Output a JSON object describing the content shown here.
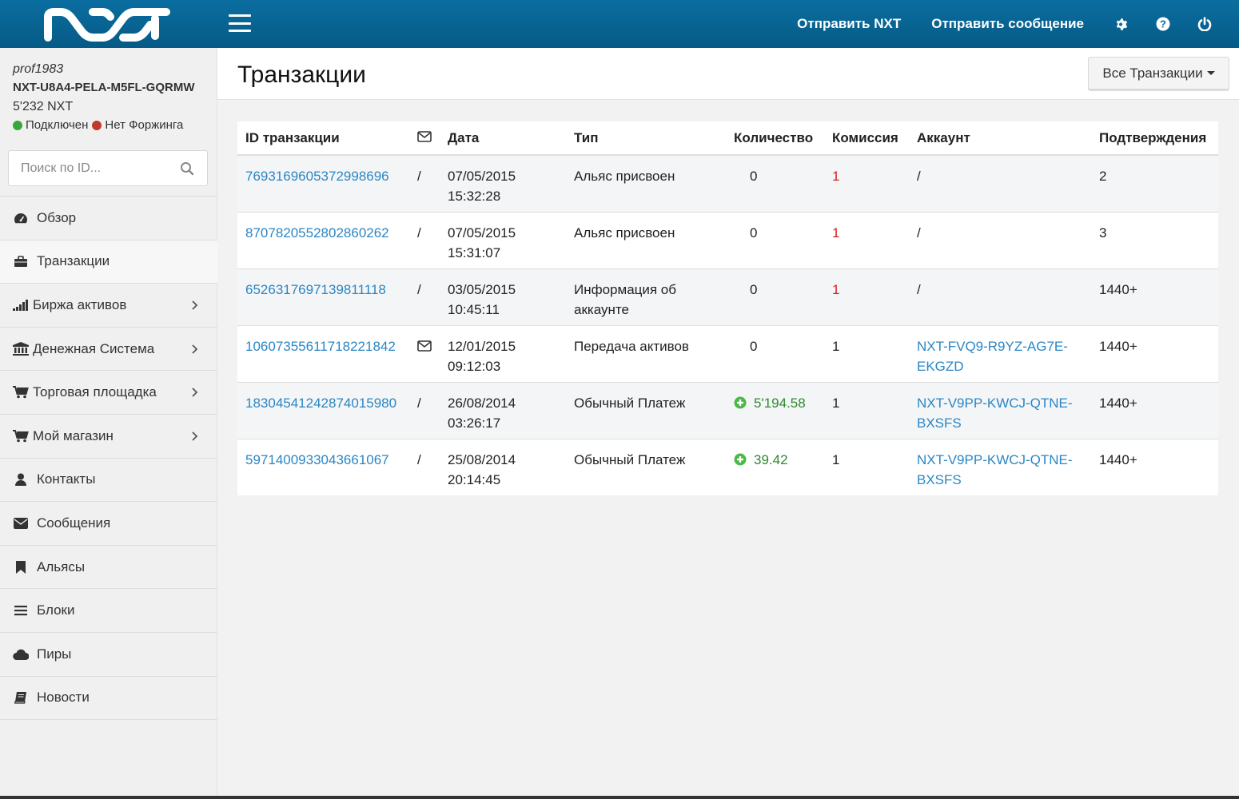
{
  "topbar": {
    "logo_text": "NXT",
    "send_nxt": "Отправить NXT",
    "send_message": "Отправить сообщение",
    "icons": [
      "gear-icon",
      "help-icon",
      "power-icon"
    ],
    "color": "#0a6ea0"
  },
  "user": {
    "username": "prof1983",
    "account": "NXT-U8A4-PELA-M5FL-GQRMW",
    "balance": "5'232 NXT",
    "connected": "Подключен",
    "forging": "Нет Форжинга",
    "connected_color": "#3aa63a",
    "forging_color": "#c0392b"
  },
  "search": {
    "placeholder": "Поиск по ID..."
  },
  "sidebar": {
    "items": [
      {
        "label": "Обзор",
        "icon": "dashboard-icon"
      },
      {
        "label": "Транзакции",
        "icon": "briefcase-icon"
      },
      {
        "label": "Биржа активов",
        "icon": "signal-icon"
      },
      {
        "label": "Денежная Система",
        "icon": "bank-icon"
      },
      {
        "label": "Торговая площадка",
        "icon": "cart-icon"
      },
      {
        "label": "Мой магазин",
        "icon": "cart-icon"
      },
      {
        "label": "Контакты",
        "icon": "user-icon"
      },
      {
        "label": "Сообщения",
        "icon": "envelope-icon"
      },
      {
        "label": "Альясы",
        "icon": "bookmark-icon"
      },
      {
        "label": "Блоки",
        "icon": "list-icon"
      },
      {
        "label": "Пиры",
        "icon": "cloud-icon"
      },
      {
        "label": "Новости",
        "icon": "book-icon"
      }
    ]
  },
  "page": {
    "title": "Транзакции",
    "filter_label": "Все Транзакции"
  },
  "table": {
    "headers": {
      "id": "ID транзакции",
      "msg": "",
      "date": "Дата",
      "type": "Тип",
      "amount": "Количество",
      "fee": "Комиссия",
      "account": "Аккаунт",
      "confirmations": "Подтверждения"
    },
    "rows": [
      {
        "id": "7693169605372998696",
        "msg": "/",
        "date": "07/05/2015",
        "time": "15:32:28",
        "type": "Альяс присвоен",
        "amount": "0",
        "fee": "1",
        "account": "/",
        "confirmations": "2"
      },
      {
        "id": "8707820552802860262",
        "msg": "/",
        "date": "07/05/2015",
        "time": "15:31:07",
        "type": "Альяс присвоен",
        "amount": "0",
        "fee": "1",
        "account": "/",
        "confirmations": "3"
      },
      {
        "id": "6526317697139811118",
        "msg": "/",
        "date": "03/05/2015",
        "time": "10:45:11",
        "type": "Информация об аккаунте",
        "amount": "0",
        "fee": "1",
        "account": "/",
        "confirmations": "1440+"
      },
      {
        "id": "10607355611718221842",
        "msg": "",
        "date": "12/01/2015",
        "time": "09:12:03",
        "type": "Передача активов",
        "amount": "0",
        "fee": "1",
        "account": "NXT-FVQ9-R9YZ-AG7E-EKGZD",
        "confirmations": "1440+"
      },
      {
        "id": "18304541242874015980",
        "msg": "/",
        "date": "26/08/2014",
        "time": "03:26:17",
        "type": "Обычный Платеж",
        "amount": "5'194.58",
        "fee": "1",
        "account": "NXT-V9PP-KWCJ-QTNE-BXSFS",
        "confirmations": "1440+"
      },
      {
        "id": "5971400933043661067",
        "msg": "/",
        "date": "25/08/2014",
        "time": "20:14:45",
        "type": "Обычный Платеж",
        "amount": "39.42",
        "fee": "1",
        "account": "NXT-V9PP-KWCJ-QTNE-BXSFS",
        "confirmations": "1440+"
      }
    ]
  },
  "colors": {
    "link": "#2b86c4",
    "fee_red": "#d51d1d",
    "amount_green": "#2d8a2d"
  }
}
